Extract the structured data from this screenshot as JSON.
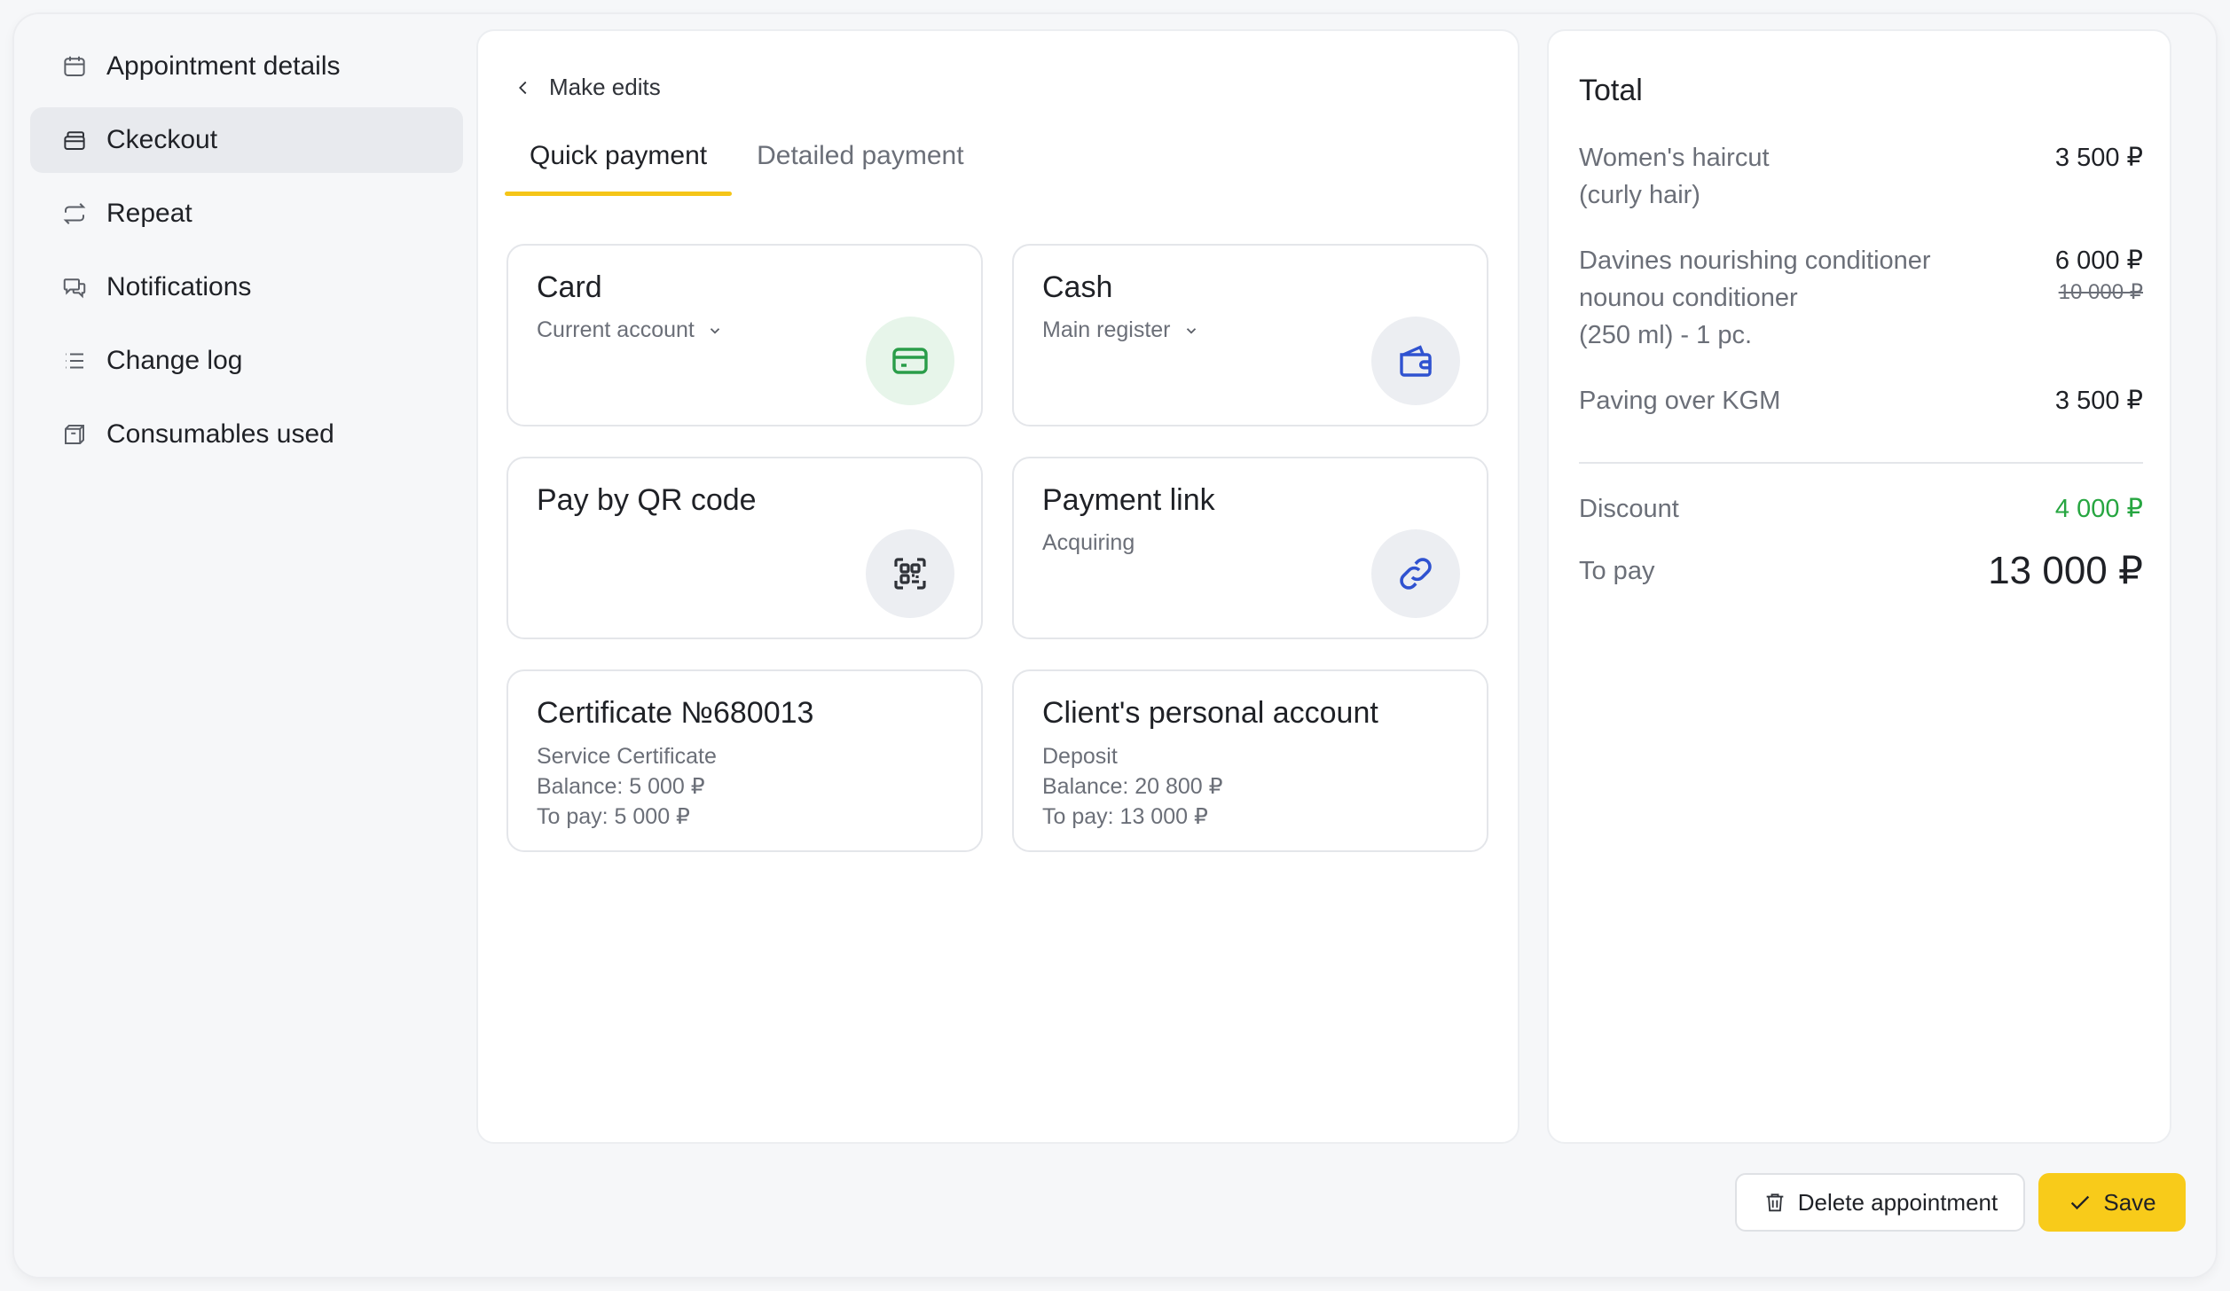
{
  "sidebar": {
    "items": [
      {
        "label": "Appointment details",
        "icon": "calendar-icon"
      },
      {
        "label": "Ckeckout",
        "icon": "cash-register-icon",
        "active": true
      },
      {
        "label": "Repeat",
        "icon": "repeat-icon"
      },
      {
        "label": "Notifications",
        "icon": "chat-bubbles-icon"
      },
      {
        "label": "Change log",
        "icon": "list-icon"
      },
      {
        "label": "Consumables used",
        "icon": "box-icon"
      }
    ]
  },
  "main": {
    "back_label": "Make edits",
    "tabs": [
      {
        "label": "Quick payment",
        "active": true
      },
      {
        "label": "Detailed payment",
        "active": false
      }
    ],
    "payment_methods": {
      "card": {
        "title": "Card",
        "subtitle": "Current account",
        "icon": "credit-card-icon"
      },
      "cash": {
        "title": "Cash",
        "subtitle": "Main register",
        "icon": "wallet-icon"
      },
      "qr": {
        "title": "Pay by QR code",
        "icon": "qr-code-icon"
      },
      "link": {
        "title": "Payment link",
        "subtitle": "Acquiring",
        "icon": "link-icon"
      },
      "certificate": {
        "title": "Certificate №680013",
        "subtitle": "Service Certificate",
        "balance": "Balance: 5 000 ₽",
        "to_pay": "To pay: 5 000 ₽"
      },
      "personal_account": {
        "title": "Client's personal account",
        "subtitle": "Deposit",
        "balance": "Balance: 20 800 ₽",
        "to_pay": "To pay: 13 000 ₽"
      }
    }
  },
  "summary": {
    "title": "Total",
    "items": [
      {
        "name_line1": "Women's haircut",
        "name_line2": "(curly hair)",
        "price": "3 500 ₽"
      },
      {
        "name_line1": "Davines nourishing conditioner",
        "name_line2": "nounou conditioner",
        "name_line3": "(250 ml) - 1 pc.",
        "price": "6 000 ₽",
        "old_price": "10 000 ₽"
      },
      {
        "name_line1": "Paving over KGM",
        "price": "3 500 ₽"
      }
    ],
    "discount_label": "Discount",
    "discount_value": "4 000 ₽",
    "to_pay_label": "To pay",
    "to_pay_value": "13 000 ₽"
  },
  "footer": {
    "delete_label": "Delete appointment",
    "save_label": "Save"
  },
  "colors": {
    "accent": "#f8cb1a",
    "discount": "#27a641",
    "card_icon": "#2a9d49",
    "link_icon": "#2f52d0"
  }
}
